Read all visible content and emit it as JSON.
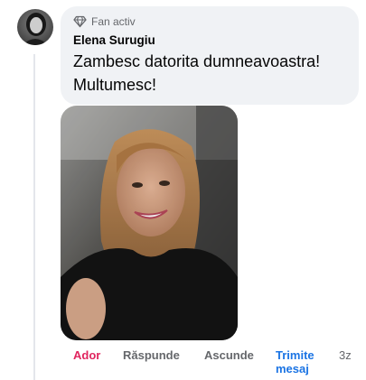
{
  "comment": {
    "badge": {
      "icon": "diamond-icon",
      "label": "Fan activ"
    },
    "author": "Elena Surugiu",
    "text": "Zambesc datorita dumneavoastra! Multumesc!",
    "avatar": "profile-avatar",
    "photo": "attached-photo"
  },
  "actions": {
    "like": "Ador",
    "reply": "Răspunde",
    "hide": "Ascunde",
    "send_line1": "Trimite",
    "send_line2": "mesaj",
    "timestamp": "3z"
  },
  "colors": {
    "bubble": "#f0f2f5",
    "like": "#e0245e",
    "link": "#1b74e4",
    "muted": "#65676b"
  }
}
